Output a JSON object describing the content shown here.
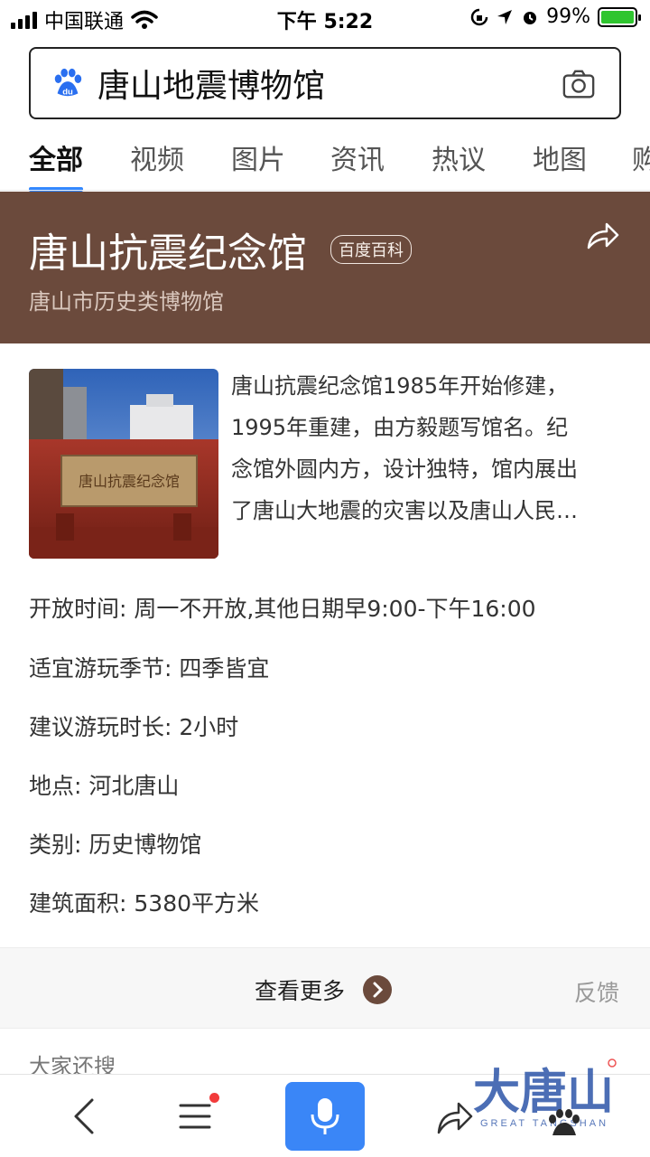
{
  "status_bar": {
    "carrier": "中国联通",
    "time": "下午 5:22",
    "battery_percent": "99%",
    "battery_level": 0.99,
    "icons": [
      "signal-icon",
      "wifi-icon",
      "rotation-lock-icon",
      "location-icon",
      "alarm-icon",
      "battery-icon"
    ]
  },
  "search": {
    "query": "唐山地震博物馆",
    "logo_text": "du",
    "camera_icon": "camera-icon"
  },
  "tabs": [
    {
      "label": "全部",
      "active": true
    },
    {
      "label": "视频",
      "active": false
    },
    {
      "label": "图片",
      "active": false
    },
    {
      "label": "资讯",
      "active": false
    },
    {
      "label": "热议",
      "active": false
    },
    {
      "label": "地图",
      "active": false
    },
    {
      "label": "购",
      "active": false
    }
  ],
  "card": {
    "title": "唐山抗震纪念馆",
    "badge": "百度百科",
    "subtitle": "唐山市历史类博物馆",
    "summary_lines": [
      "唐山抗震纪念馆1985年开始修建，",
      "1995年重建，由方毅题写馆名。纪",
      "念馆外圆内方，设计独特，馆内展出",
      "了唐山大地震的灾害以及唐山人民…"
    ],
    "photo_sign": "唐山抗震纪念馆",
    "info": [
      {
        "label": "开放时间:",
        "value": "周一不开放,其他日期早9:00-下午16:00"
      },
      {
        "label": "适宜游玩季节:",
        "value": "四季皆宜"
      },
      {
        "label": "建议游玩时长:",
        "value": "2小时"
      },
      {
        "label": "地点:",
        "value": "河北唐山"
      },
      {
        "label": "类别:",
        "value": "历史博物馆"
      },
      {
        "label": "建筑面积:",
        "value": "5380平方米"
      }
    ],
    "more_label": "查看更多",
    "feedback_label": "反馈"
  },
  "related_heading": "大家还搜",
  "watermark": {
    "text": "大唐山",
    "sub": "GREAT TANGSHAN"
  },
  "colors": {
    "hero_bg": "#6b4a3c",
    "accent_blue": "#3388ff",
    "mic_blue": "#3a86f7",
    "badge_red": "#f23b3b"
  }
}
